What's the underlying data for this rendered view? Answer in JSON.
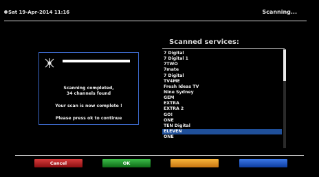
{
  "header": {
    "datetime": "Sat 19-Apr-2014  11:16",
    "status": "Scanning..."
  },
  "services": {
    "title": "Scanned services:",
    "items": [
      "7 Digital",
      "7 Digital 1",
      "7TWO",
      "7mate",
      "7 Digital",
      "TV4ME",
      "Fresh Ideas TV",
      "Nine Sydney",
      "GEM",
      "EXTRA",
      "EXTRA 2",
      "GO!",
      "ONE",
      "TEN Digital",
      "ELEVEN",
      "ONE"
    ],
    "selected_index": 14
  },
  "dialog": {
    "progress_fraction": 1.0,
    "line1": "Scanning completed,",
    "line2": "34 channels found",
    "line3": "Your scan is now complete !",
    "line4": "Please press ok to continue"
  },
  "buttons": {
    "red": "Cancel",
    "green": "OK",
    "yellow": "",
    "blue": ""
  },
  "colors": {
    "selection": "#1f4f99",
    "dialog_border": "#3a66c4"
  }
}
